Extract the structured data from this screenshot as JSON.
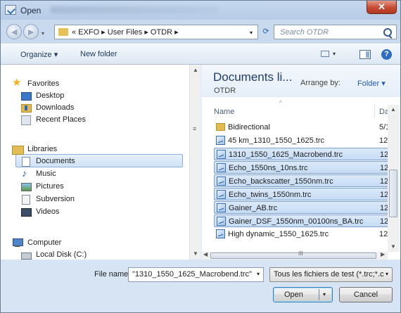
{
  "window": {
    "title": "Open",
    "close_glyph": "✕"
  },
  "nav": {
    "back_glyph": "◀",
    "forward_glyph": "▶",
    "recent_glyph": "▾",
    "address": "« EXFO ▸ User Files ▸ OTDR ▸",
    "address_dropdown": "▾",
    "refresh_glyph": "⟳",
    "search_placeholder": "Search OTDR"
  },
  "toolbar": {
    "organize": "Organize ▾",
    "new_folder": "New folder",
    "views_arrow": "▾",
    "help": "?"
  },
  "sidebar": {
    "favorites": {
      "label": "Favorites",
      "items": [
        "Desktop",
        "Downloads",
        "Recent Places"
      ]
    },
    "libraries": {
      "label": "Libraries",
      "items": [
        "Documents",
        "Music",
        "Pictures",
        "Subversion",
        "Videos"
      ]
    },
    "computer": {
      "label": "Computer",
      "items": [
        "Local Disk (C:)"
      ]
    },
    "selected": "Documents",
    "scroll_up": "▲",
    "scroll_down": "▼",
    "scroll_grip": "≡"
  },
  "filepane": {
    "title": "Documents li...",
    "subtitle": "OTDR",
    "arrange_label": "Arrange by:",
    "arrange_value": "Folder ▾",
    "columns": {
      "name": "Name",
      "date": "Da",
      "sort_glyph": "^"
    },
    "files": [
      {
        "name": "Bidirectional",
        "date": "5/1",
        "type": "folder",
        "selected": false
      },
      {
        "name": "45 km_1310_1550_1625.trc",
        "date": "12/",
        "type": "trc",
        "selected": false
      },
      {
        "name": "1310_1550_1625_Macrobend.trc",
        "date": "12/",
        "type": "trc",
        "selected": true
      },
      {
        "name": "Echo_1550ns_10ns.trc",
        "date": "12/",
        "type": "trc",
        "selected": true
      },
      {
        "name": "Echo_backscatter_1550nm.trc",
        "date": "12/",
        "type": "trc",
        "selected": true
      },
      {
        "name": "Echo_twins_1550nm.trc",
        "date": "12/",
        "type": "trc",
        "selected": true
      },
      {
        "name": "Gainer_AB.trc",
        "date": "12/",
        "type": "trc",
        "selected": true
      },
      {
        "name": "Gainer_DSF_1550nm_00100ns_BA.trc",
        "date": "12/",
        "type": "trc",
        "selected": true
      },
      {
        "name": "High dynamic_1550_1625.trc",
        "date": "12/",
        "type": "trc",
        "selected": false
      }
    ],
    "scroll_up": "▲",
    "scroll_down": "▼",
    "scroll_left": "◀",
    "scroll_right": "▶",
    "hscroll_grip": "III"
  },
  "footer": {
    "file_name_label": "File name:",
    "file_name_value": "\"1310_1550_1625_Macrobend.trc\"",
    "dropdown_glyph": "▾",
    "filter_value": "Tous les fichiers de test (*.trc;*.c",
    "open_label": "Open",
    "open_split_glyph": "▾",
    "cancel_label": "Cancel"
  }
}
